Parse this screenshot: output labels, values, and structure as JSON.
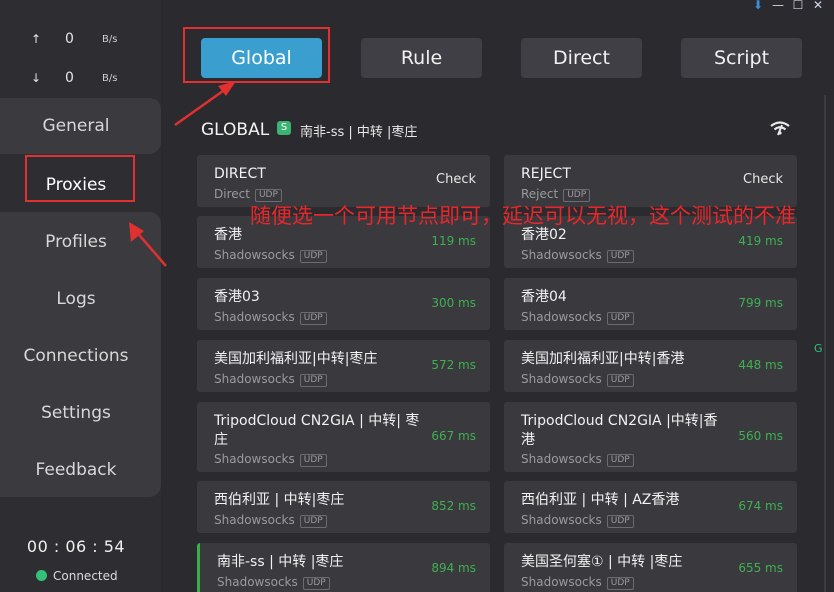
{
  "traffic": {
    "upload": {
      "arrow": "↑",
      "value": "0",
      "unit": "B/s"
    },
    "download": {
      "arrow": "↓",
      "value": "0",
      "unit": "B/s"
    }
  },
  "nav": {
    "general": "General",
    "proxies": "Proxies",
    "profiles": "Profiles",
    "logs": "Logs",
    "connections": "Connections",
    "settings": "Settings",
    "feedback": "Feedback"
  },
  "status": {
    "timer": "00 : 06 : 54",
    "connected": "Connected",
    "color": "#35c07a"
  },
  "modes": {
    "global": "Global",
    "rule": "Rule",
    "direct": "Direct",
    "script": "Script"
  },
  "group": {
    "title": "GLOBAL",
    "badge": "S",
    "selected": "南非-ss | 中转 |枣庄"
  },
  "side_mark": "G",
  "proxies": [
    {
      "name": "DIRECT",
      "type": "Direct",
      "udp": "UDP",
      "action": "Check"
    },
    {
      "name": "REJECT",
      "type": "Reject",
      "udp": "UDP",
      "action": "Check"
    },
    {
      "name": "香港",
      "type": "Shadowsocks",
      "udp": "UDP",
      "delay": "119 ms"
    },
    {
      "name": "香港02",
      "type": "Shadowsocks",
      "udp": "UDP",
      "delay": "419 ms"
    },
    {
      "name": "香港03",
      "type": "Shadowsocks",
      "udp": "UDP",
      "delay": "300 ms"
    },
    {
      "name": "香港04",
      "type": "Shadowsocks",
      "udp": "UDP",
      "delay": "799 ms"
    },
    {
      "name": "美国加利福利亚|中转|枣庄",
      "type": "Shadowsocks",
      "udp": "UDP",
      "delay": "572 ms"
    },
    {
      "name": "美国加利福利亚|中转|香港",
      "type": "Shadowsocks",
      "udp": "UDP",
      "delay": "448 ms"
    },
    {
      "name": "TripodCloud CN2GIA | 中转| 枣庄",
      "type": "Shadowsocks",
      "udp": "UDP",
      "delay": "667 ms"
    },
    {
      "name": "TripodCloud CN2GIA |中转|香港",
      "type": "Shadowsocks",
      "udp": "UDP",
      "delay": "560 ms"
    },
    {
      "name": "西伯利亚 | 中转|枣庄",
      "type": "Shadowsocks",
      "udp": "UDP",
      "delay": "852 ms"
    },
    {
      "name": "西伯利亚 | 中转 | AZ香港",
      "type": "Shadowsocks",
      "udp": "UDP",
      "delay": "674 ms"
    },
    {
      "name": "南非-ss | 中转 |枣庄",
      "type": "Shadowsocks",
      "udp": "UDP",
      "delay": "894 ms",
      "selected": true
    },
    {
      "name": "美国圣何塞① | 中转 |枣庄",
      "type": "Shadowsocks",
      "udp": "UDP",
      "delay": "655 ms"
    }
  ],
  "annotation": {
    "text": "随便选一个可用节点即可，延迟可以无视，这个测试的不准",
    "color": "#e0302f"
  },
  "colors": {
    "accent": "#3a9fcf",
    "delay_green": "#3fb050"
  }
}
